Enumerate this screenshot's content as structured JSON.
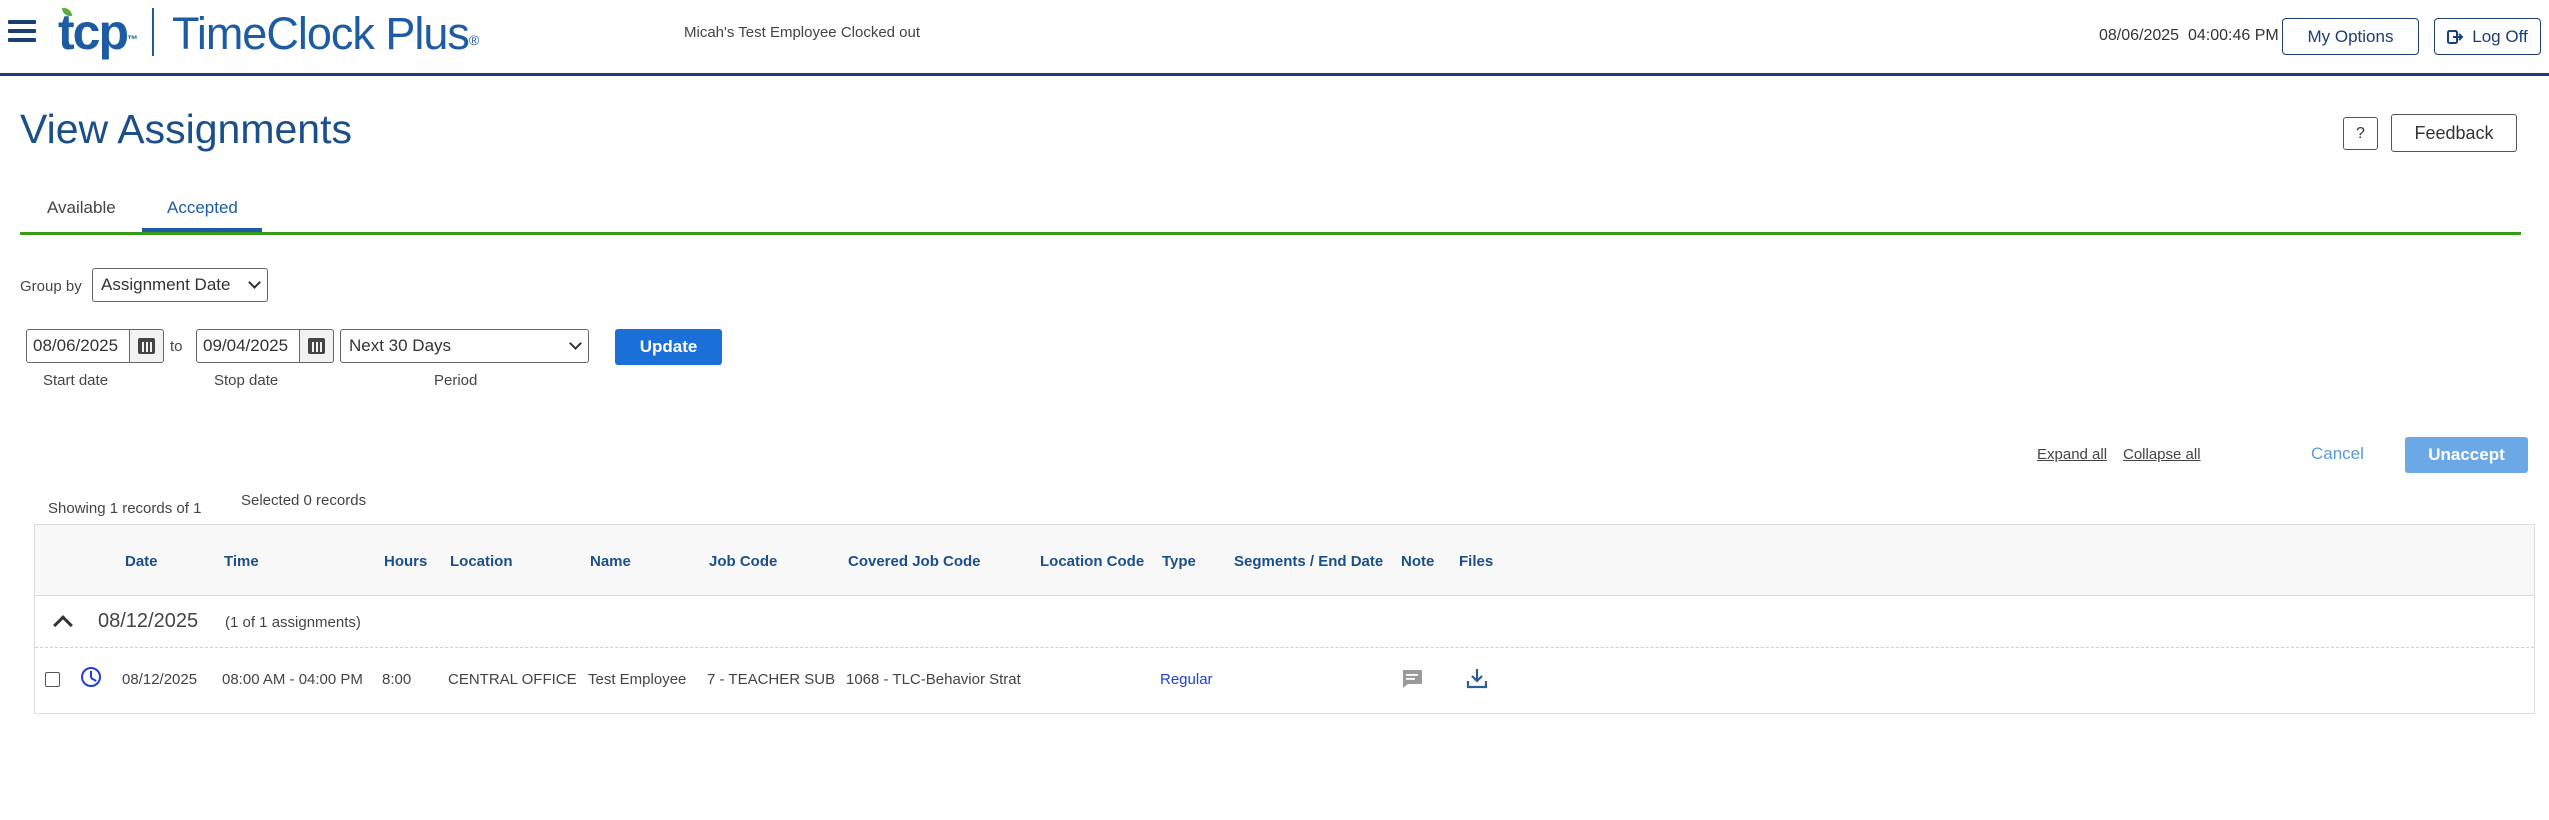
{
  "header": {
    "logo_short": "tcp",
    "logo_tm": "™",
    "logo_name": "TimeClock Plus",
    "logo_reg": "®",
    "status_text": "Micah's Test Employee Clocked out",
    "datetime": "08/06/2025  04:00:46 PM",
    "my_options_label": "My Options",
    "log_off_label": "Log Off"
  },
  "page": {
    "title": "View Assignments",
    "help_label": "?",
    "feedback_label": "Feedback"
  },
  "tabs": [
    {
      "label": "Available",
      "active": false
    },
    {
      "label": "Accepted",
      "active": true
    }
  ],
  "filters": {
    "group_by_label": "Group by",
    "group_by_value": "Assignment Date",
    "start_date": "08/06/2025",
    "stop_date": "09/04/2025",
    "to_label": "to",
    "period_value": "Next 30 Days",
    "start_label": "Start date",
    "stop_label": "Stop date",
    "period_label": "Period",
    "update_label": "Update"
  },
  "actions": {
    "expand_all": "Expand all",
    "collapse_all": "Collapse all",
    "cancel": "Cancel",
    "unaccept": "Unaccept"
  },
  "summary": {
    "showing": "Showing 1 records of 1",
    "selected": "Selected 0 records"
  },
  "table": {
    "columns": [
      "Date",
      "Time",
      "Hours",
      "Location",
      "Name",
      "Job Code",
      "Covered Job Code",
      "Location Code",
      "Type",
      "Segments / End Date",
      "Note",
      "Files"
    ],
    "group": {
      "date": "08/12/2025",
      "count_text": "(1 of 1 assignments)"
    },
    "rows": [
      {
        "date": "08/12/2025",
        "time": "08:00 AM - 04:00 PM",
        "hours": "8:00",
        "location": "CENTRAL OFFICE",
        "name": "Test Employee",
        "job_code": "7 - TEACHER SUB",
        "covered_job_code": "1068 - TLC-Behavior Strat",
        "location_code": "",
        "type": "Regular",
        "segments_end_date": ""
      }
    ]
  },
  "colors": {
    "brand_blue": "#1b4f8a",
    "header_rule": "#1b3f73",
    "tab_rule_green": "#3a9a1a",
    "primary_button": "#1a6fd8",
    "disabled_button": "#6ca8e6",
    "link_blue": "#1f3fd6"
  },
  "icons": [
    "hamburger-menu-icon",
    "log-off-icon",
    "calendar-icon",
    "chevron-down-icon",
    "chevron-up-icon",
    "clock-icon",
    "note-icon",
    "download-icon"
  ]
}
